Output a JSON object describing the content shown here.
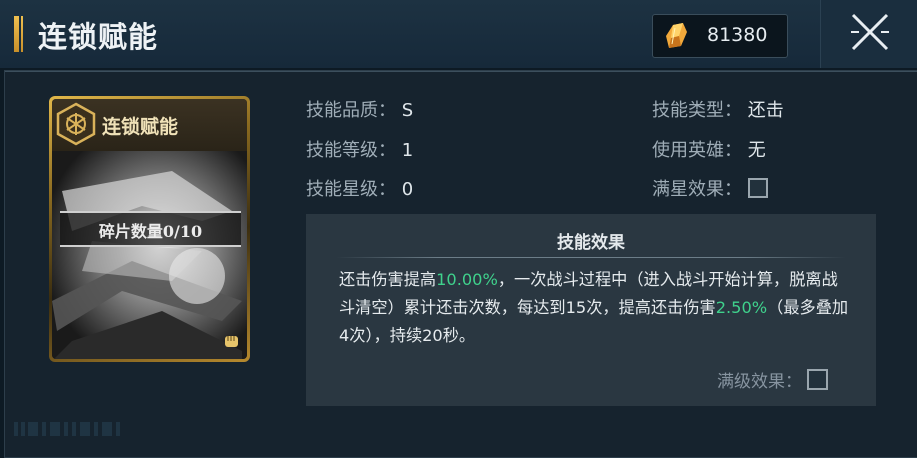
{
  "header": {
    "title": "连锁赋能",
    "currency_icon": "gold-crystal-icon",
    "currency_value": "81380",
    "close_icon": "close-x-icon"
  },
  "card": {
    "title": "连锁赋能",
    "emblem_icon": "hexagon-emblem-icon",
    "fragment_label": "碎片数量0/10",
    "corner_icon": "fist-icon"
  },
  "info": {
    "quality_label": "技能品质：",
    "quality_value": "S",
    "level_label": "技能等级：",
    "level_value": "1",
    "star_label": "技能星级：",
    "star_value": "0",
    "type_label": "技能类型：",
    "type_value": "还击",
    "hero_label": "使用英雄：",
    "hero_value": "无",
    "fullstar_label": "满星效果："
  },
  "effect": {
    "title": "技能效果",
    "seg1": "还击伤害提高",
    "hl1": "10.00%",
    "seg2": "，一次战斗过程中（进入战斗开始计算，脱离战斗清空）累计还击次数，每达到15次，提高还击伤害",
    "hl2": "2.50%",
    "seg3": "（最多叠加4次），持续20秒。",
    "fulllevel_label": "满级效果："
  },
  "colors": {
    "accent_gold": "#e2b84a",
    "highlight_green": "#3fd18c",
    "background": "#16232e"
  }
}
